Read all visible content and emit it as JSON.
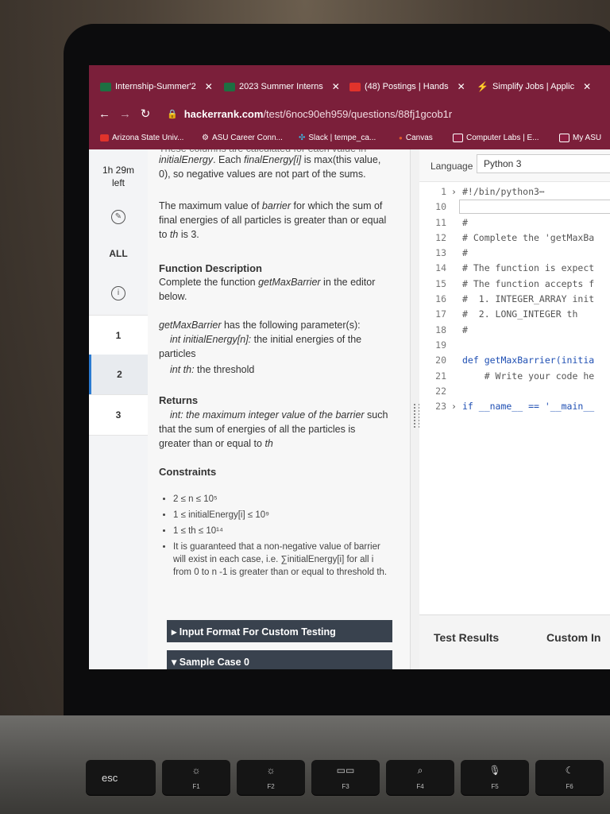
{
  "browser": {
    "tabs": [
      {
        "label": "Internship-Summer'2",
        "favicon_color": "#1d6f42"
      },
      {
        "label": "2023 Summer Interns",
        "favicon_color": "#1d6f42"
      },
      {
        "label": "(48) Postings | Hands",
        "favicon_color": "#e0332b"
      },
      {
        "label": "Simplify Jobs | Applic",
        "favicon_color": "#3a6bd6"
      }
    ],
    "url_host": "hackerrank.com",
    "url_path": "/test/6noc90eh959/questions/88fj1gcob1r",
    "bookmarks": [
      {
        "label": "Arizona State Univ...",
        "color": "#e0332b"
      },
      {
        "label": "ASU Career Conn...",
        "color": "#cfcfcf"
      },
      {
        "label": "Slack | tempe_ca...",
        "color": "#36c5f0"
      },
      {
        "label": "Canvas",
        "color": "#e05a2a"
      },
      {
        "label": "Computer Labs | E...",
        "color": "#8c1d40"
      },
      {
        "label": "My ASU",
        "color": "#8c1d40"
      }
    ]
  },
  "sidebar": {
    "timer": "1h 29m",
    "timer_sub": "left",
    "all_label": "ALL",
    "questions": [
      "1",
      "2",
      "3"
    ]
  },
  "problem": {
    "intro_partial": "These columns are calculated for each value in",
    "intro_line2_a": "initialEnergy",
    "intro_line2_b": ". Each ",
    "intro_line2_c": "finalEnergy[i]",
    "intro_line2_d": " is max(this value,",
    "intro_line3": "0), so negative values are not part of the sums.",
    "max_a": "The maximum value of ",
    "max_b": "barrier",
    "max_c": " for which the sum of final energies of all particles is greater than or equal to ",
    "max_d": "th",
    "max_e": " is 3.",
    "func_heading": "Function Description",
    "func_a": "Complete the function ",
    "func_b": "getMaxBarrier",
    "func_c": " in the editor below.",
    "params_a": "getMaxBarrier",
    "params_b": " has the following parameter(s):",
    "param1_a": "int initialEnergy[n]:",
    "param1_b": " the initial energies of the particles",
    "param2_a": "int th:",
    "param2_b": " the threshold",
    "returns_heading": "Returns",
    "returns_a": "int: the maximum integer value of the ",
    "returns_b": "barrier",
    "returns_c": " such that the sum of energies of all the particles is greater than or equal to ",
    "returns_d": "th",
    "constraints_heading": "Constraints",
    "constraints": [
      "2 ≤ n ≤ 10⁵",
      "1 ≤ initialEnergy[i] ≤ 10⁹",
      "1 ≤ th ≤ 10¹⁴",
      "It is guaranteed that a non-negative value of barrier will exist in each case, i.e. ∑initialEnergy[i] for all i from 0 to n -1 is greater than or equal to threshold th."
    ],
    "input_format": "▸ Input Format For Custom Testing",
    "sample_case": "▾ Sample Case 0"
  },
  "editor": {
    "language_label": "Language",
    "language_value": "Python 3",
    "lines": [
      {
        "n": "1",
        "fold": "›",
        "text": "#!/bin/python3⋯",
        "cls": "cmt"
      },
      {
        "n": "10",
        "fold": "",
        "text": "",
        "cls": "cmt"
      },
      {
        "n": "11",
        "fold": "",
        "text": "#",
        "cls": "cmt"
      },
      {
        "n": "12",
        "fold": "",
        "text": "# Complete the 'getMaxBa",
        "cls": "cmt"
      },
      {
        "n": "13",
        "fold": "",
        "text": "#",
        "cls": "cmt"
      },
      {
        "n": "14",
        "fold": "",
        "text": "# The function is expect",
        "cls": "cmt"
      },
      {
        "n": "15",
        "fold": "",
        "text": "# The function accepts f",
        "cls": "cmt"
      },
      {
        "n": "16",
        "fold": "",
        "text": "#  1. INTEGER_ARRAY init",
        "cls": "cmt"
      },
      {
        "n": "17",
        "fold": "",
        "text": "#  2. LONG_INTEGER th",
        "cls": "cmt"
      },
      {
        "n": "18",
        "fold": "",
        "text": "#",
        "cls": "cmt"
      },
      {
        "n": "19",
        "fold": "",
        "text": "",
        "cls": "cmt"
      },
      {
        "n": "20",
        "fold": "",
        "text": "def getMaxBarrier(initia",
        "cls": "kw"
      },
      {
        "n": "21",
        "fold": "",
        "text": "    # Write your code he",
        "cls": "cmt"
      },
      {
        "n": "22",
        "fold": "",
        "text": "",
        "cls": "cmt"
      },
      {
        "n": "23",
        "fold": "›",
        "text": "if __name__ == '__main__",
        "cls": "kw"
      }
    ],
    "test_results": "Test Results",
    "custom_input": "Custom In"
  },
  "keyboard": {
    "keys": [
      {
        "label": "esc",
        "icon": ""
      },
      {
        "label": "F1",
        "icon": "☼"
      },
      {
        "label": "F2",
        "icon": "☼"
      },
      {
        "label": "F3",
        "icon": "▭▭"
      },
      {
        "label": "F4",
        "icon": "⌕"
      },
      {
        "label": "F5",
        "icon": "🎙"
      },
      {
        "label": "F6",
        "icon": "☾"
      }
    ]
  }
}
